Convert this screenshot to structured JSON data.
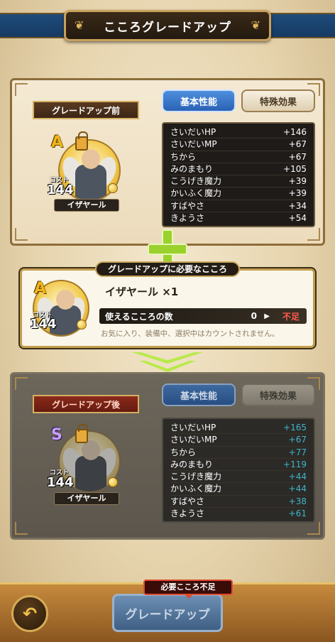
{
  "header": {
    "title": "こころグレードアップ"
  },
  "tabs": {
    "basic": "基本性能",
    "special": "特殊効果"
  },
  "before": {
    "ribbon": "グレードアップ前",
    "grade": "A",
    "cost_label": "コスト",
    "cost": "144",
    "name": "イザヤール",
    "stats": [
      {
        "label": "さいだいHP",
        "value": "+146"
      },
      {
        "label": "さいだいMP",
        "value": "+67"
      },
      {
        "label": "ちから",
        "value": "+67"
      },
      {
        "label": "みのまもり",
        "value": "+105"
      },
      {
        "label": "こうげき魔力",
        "value": "+39"
      },
      {
        "label": "かいふく魔力",
        "value": "+39"
      },
      {
        "label": "すばやさ",
        "value": "+34"
      },
      {
        "label": "きようさ",
        "value": "+54"
      }
    ]
  },
  "required": {
    "label": "グレードアップに必要なこころ",
    "grade": "A",
    "cost_label": "コスト",
    "cost": "144",
    "name_line": "イザヤール ×1",
    "usable_label": "使えるこころの数",
    "usable_count": "0",
    "shortage": "不足",
    "note": "お気に入り、装備中、選択中はカウントされません。"
  },
  "after": {
    "ribbon": "グレードアップ後",
    "grade": "S",
    "cost_label": "コスト",
    "cost": "144",
    "name": "イザヤール",
    "stats": [
      {
        "label": "さいだいHP",
        "value": "+165"
      },
      {
        "label": "さいだいMP",
        "value": "+67"
      },
      {
        "label": "ちから",
        "value": "+77"
      },
      {
        "label": "みのまもり",
        "value": "+119"
      },
      {
        "label": "こうげき魔力",
        "value": "+44"
      },
      {
        "label": "かいふく魔力",
        "value": "+44"
      },
      {
        "label": "すばやさ",
        "value": "+38"
      },
      {
        "label": "きようさ",
        "value": "+61"
      }
    ]
  },
  "footer": {
    "warning": "必要こころ不足",
    "grade_up_button": "グレードアップ",
    "back_icon": "back-arrow-icon"
  },
  "colors": {
    "accent_blue": "#2a62b5",
    "shortage_red": "#ff5a4a",
    "after_stat_cyan": "#3fb5c9",
    "plus_green": "#9bd12d"
  }
}
